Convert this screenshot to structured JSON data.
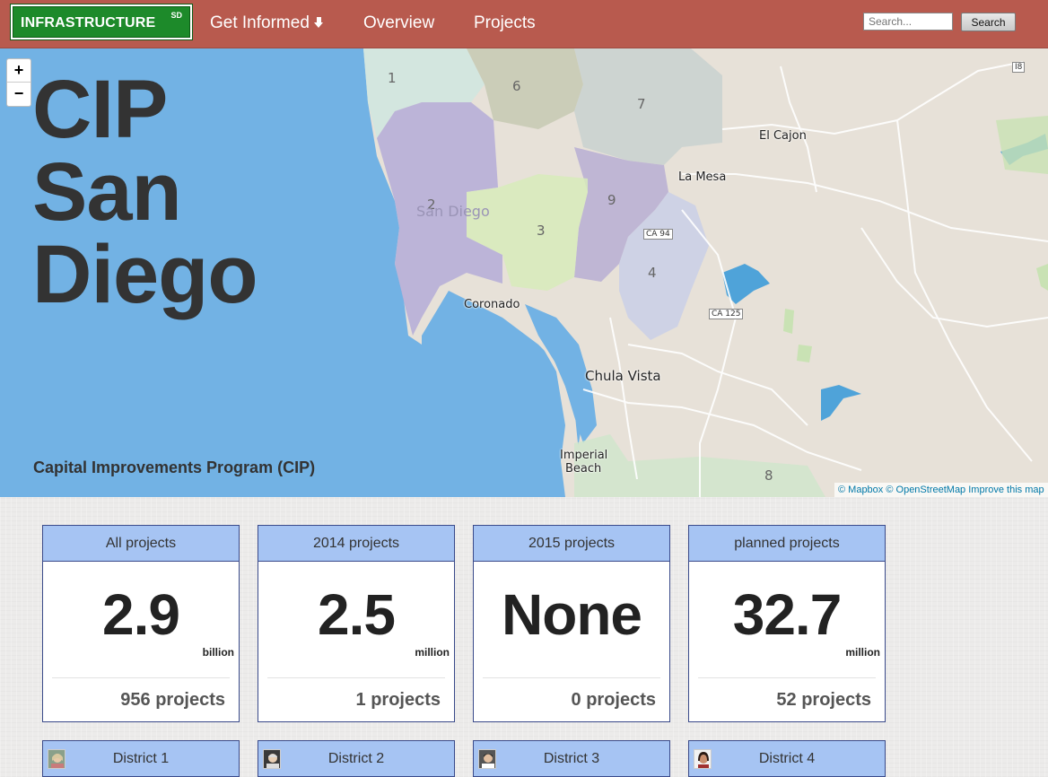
{
  "navbar": {
    "logo_text": "INFRASTRUCTURE",
    "logo_badge": "SD",
    "links": [
      {
        "label": "Get Informed"
      },
      {
        "label": "Overview"
      },
      {
        "label": "Projects"
      }
    ],
    "search_placeholder": "Search...",
    "search_button": "Search"
  },
  "hero": {
    "title_lines": [
      "CIP",
      "San",
      "Diego"
    ],
    "subtitle": "Capital Improvements Program (CIP)",
    "zoom_in": "+",
    "zoom_out": "−",
    "attribution": {
      "mapbox": "© Mapbox",
      "osm": "© OpenStreetMap",
      "improve": "Improve this map"
    },
    "places": {
      "el_cajon": "El Cajon",
      "la_mesa": "La Mesa",
      "san_diego": "San Diego",
      "coronado": "Coronado",
      "chula_vista": "Chula Vista",
      "imperial_beach_1": "Imperial",
      "imperial_beach_2": "Beach"
    },
    "districts": [
      "1",
      "2",
      "3",
      "4",
      "6",
      "7",
      "8",
      "9"
    ],
    "shields": {
      "ca125": "CA 125",
      "i8": "I8",
      "ca94": "CA 94"
    },
    "colors": {
      "ocean": "#72b2e4",
      "land": "#e7e1d8",
      "navbar": "#b85a4e",
      "card_header": "#a6c4f3"
    }
  },
  "stats": [
    {
      "header": "All projects",
      "value": "2.9",
      "unit": "billion",
      "count": "956 projects"
    },
    {
      "header": "2014 projects",
      "value": "2.5",
      "unit": "million",
      "count": "1 projects"
    },
    {
      "header": "2015 projects",
      "value": "None",
      "unit": "",
      "count": "0 projects"
    },
    {
      "header": "planned projects",
      "value": "32.7",
      "unit": "million",
      "count": "52 projects"
    }
  ],
  "district_cards": [
    {
      "label": "District 1"
    },
    {
      "label": "District 2"
    },
    {
      "label": "District 3"
    },
    {
      "label": "District 4"
    }
  ]
}
